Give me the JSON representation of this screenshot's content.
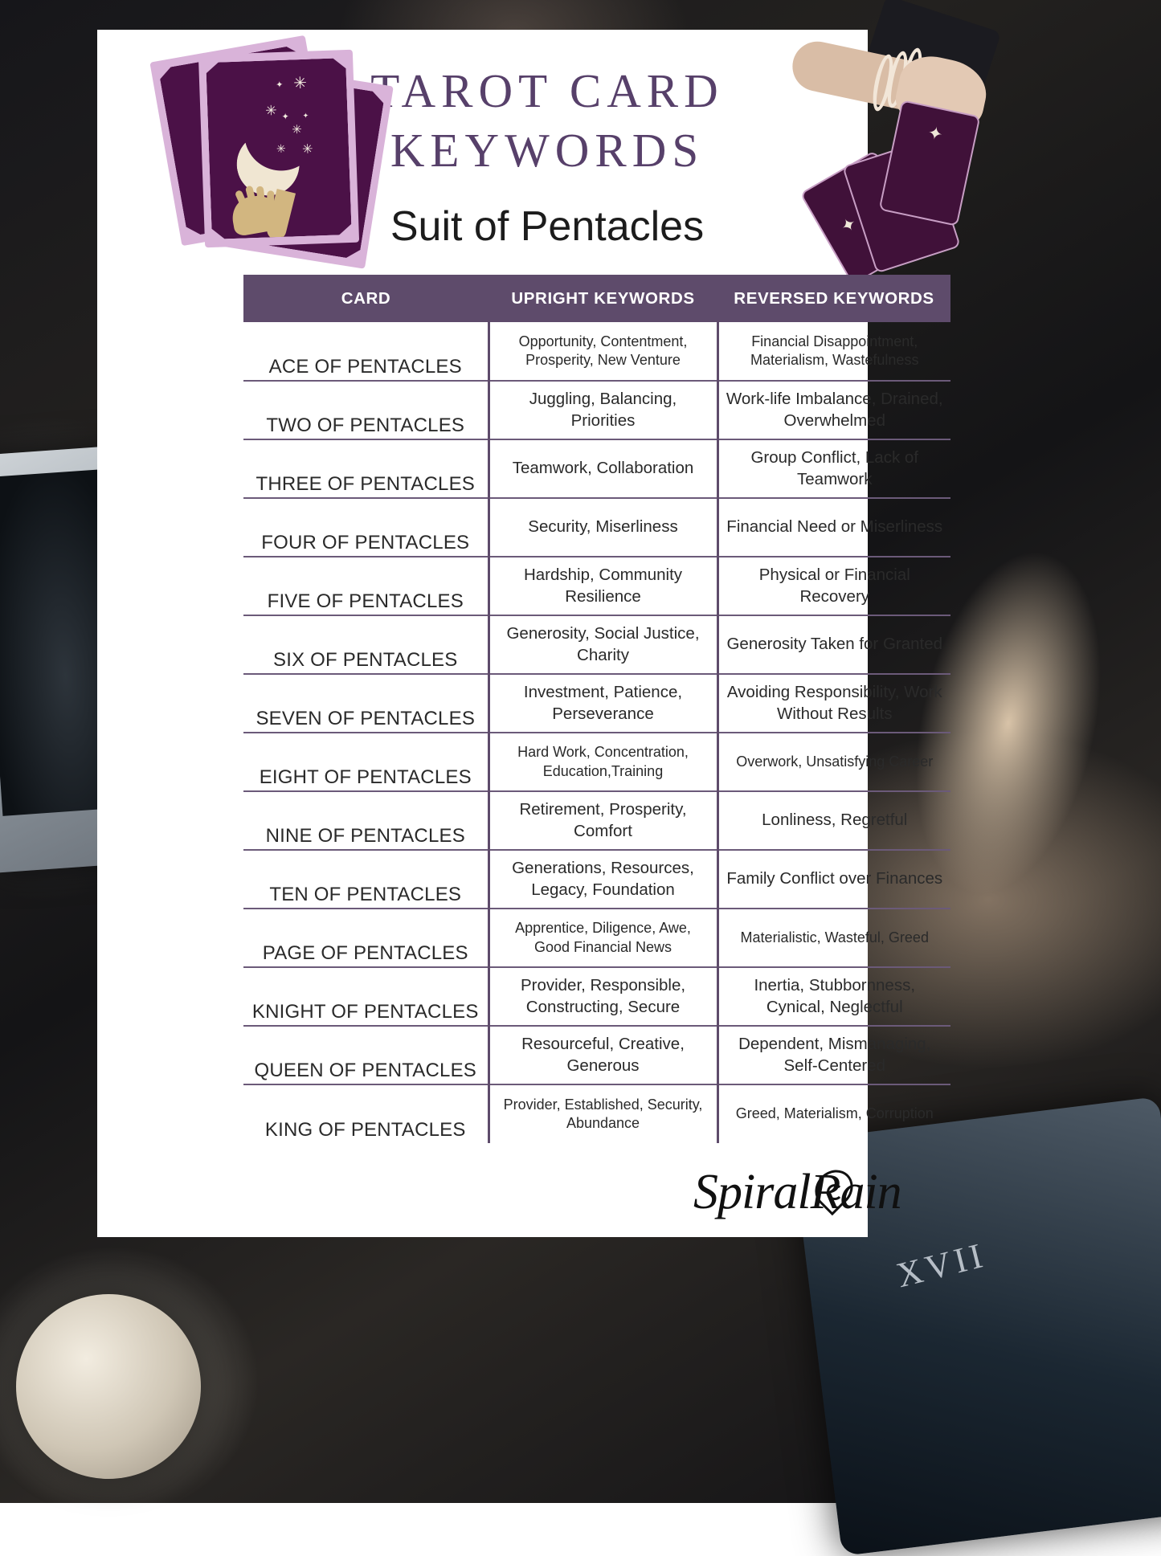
{
  "poster": {
    "title": "TAROT CARD KEYWORDS",
    "subtitle": "Suit of Pentacles",
    "brand": "SpiralRain",
    "accent_dark": "#5e4b6b",
    "accent_title": "#57406a",
    "card_purple": "#4b1147",
    "card_border_lilac": "#d9b3d9"
  },
  "table": {
    "headers": {
      "card": "CARD",
      "upright": "UPRIGHT KEYWORDS",
      "reversed": "REVERSED KEYWORDS"
    },
    "rows": [
      {
        "card": "ACE OF PENTACLES",
        "upright": "Opportunity, Contentment, Prosperity, New Venture",
        "reversed": "Financial Disappointment, Materialism, Wastefulness",
        "small": true
      },
      {
        "card": "TWO OF PENTACLES",
        "upright": "Juggling, Balancing, Priorities",
        "reversed": "Work-life Imbalance, Drained, Overwhelmed",
        "small": false
      },
      {
        "card": "THREE OF PENTACLES",
        "upright": "Teamwork, Collaboration",
        "reversed": "Group Conflict, Lack of Teamwork",
        "small": false
      },
      {
        "card": "FOUR OF PENTACLES",
        "upright": "Security, Miserliness",
        "reversed": "Financial Need or Miserliness",
        "small": false
      },
      {
        "card": "FIVE OF PENTACLES",
        "upright": "Hardship, Community Resilience",
        "reversed": "Physical or Financial Recovery",
        "small": false
      },
      {
        "card": "SIX OF PENTACLES",
        "upright": "Generosity, Social Justice, Charity",
        "reversed": "Generosity Taken for Granted",
        "small": false
      },
      {
        "card": "SEVEN OF PENTACLES",
        "upright": "Investment, Patience, Perseverance",
        "reversed": "Avoiding Responsibility, Work Without Results",
        "small": false
      },
      {
        "card": "EIGHT OF PENTACLES",
        "upright": "Hard Work, Concentration, Education,Training",
        "reversed": "Overwork, Unsatisfying Career",
        "small": true
      },
      {
        "card": "NINE OF PENTACLES",
        "upright": "Retirement, Prosperity, Comfort",
        "reversed": "Lonliness, Regretful",
        "small": false
      },
      {
        "card": "TEN OF PENTACLES",
        "upright": "Generations, Resources, Legacy, Foundation",
        "reversed": "Family Conflict over Finances",
        "small": false
      },
      {
        "card": "PAGE OF PENTACLES",
        "upright": "Apprentice, Diligence, Awe, Good Financial News",
        "reversed": "Materialistic, Wasteful, Greed",
        "small": true
      },
      {
        "card": "KNIGHT OF PENTACLES",
        "upright": "Provider, Responsible, Constructing, Secure",
        "reversed": "Inertia, Stubbornness, Cynical, Neglectful",
        "small": false
      },
      {
        "card": "QUEEN OF PENTACLES",
        "upright": "Resourceful, Creative, Generous",
        "reversed": "Dependent, Mismanaging, Self-Centered",
        "small": false
      },
      {
        "card": "KING OF PENTACLES",
        "upright": "Provider, Established, Security, Abundance",
        "reversed": "Greed, Materialism, Corruption",
        "small": true
      }
    ]
  },
  "background": {
    "tablet_numeral": "XVII"
  }
}
